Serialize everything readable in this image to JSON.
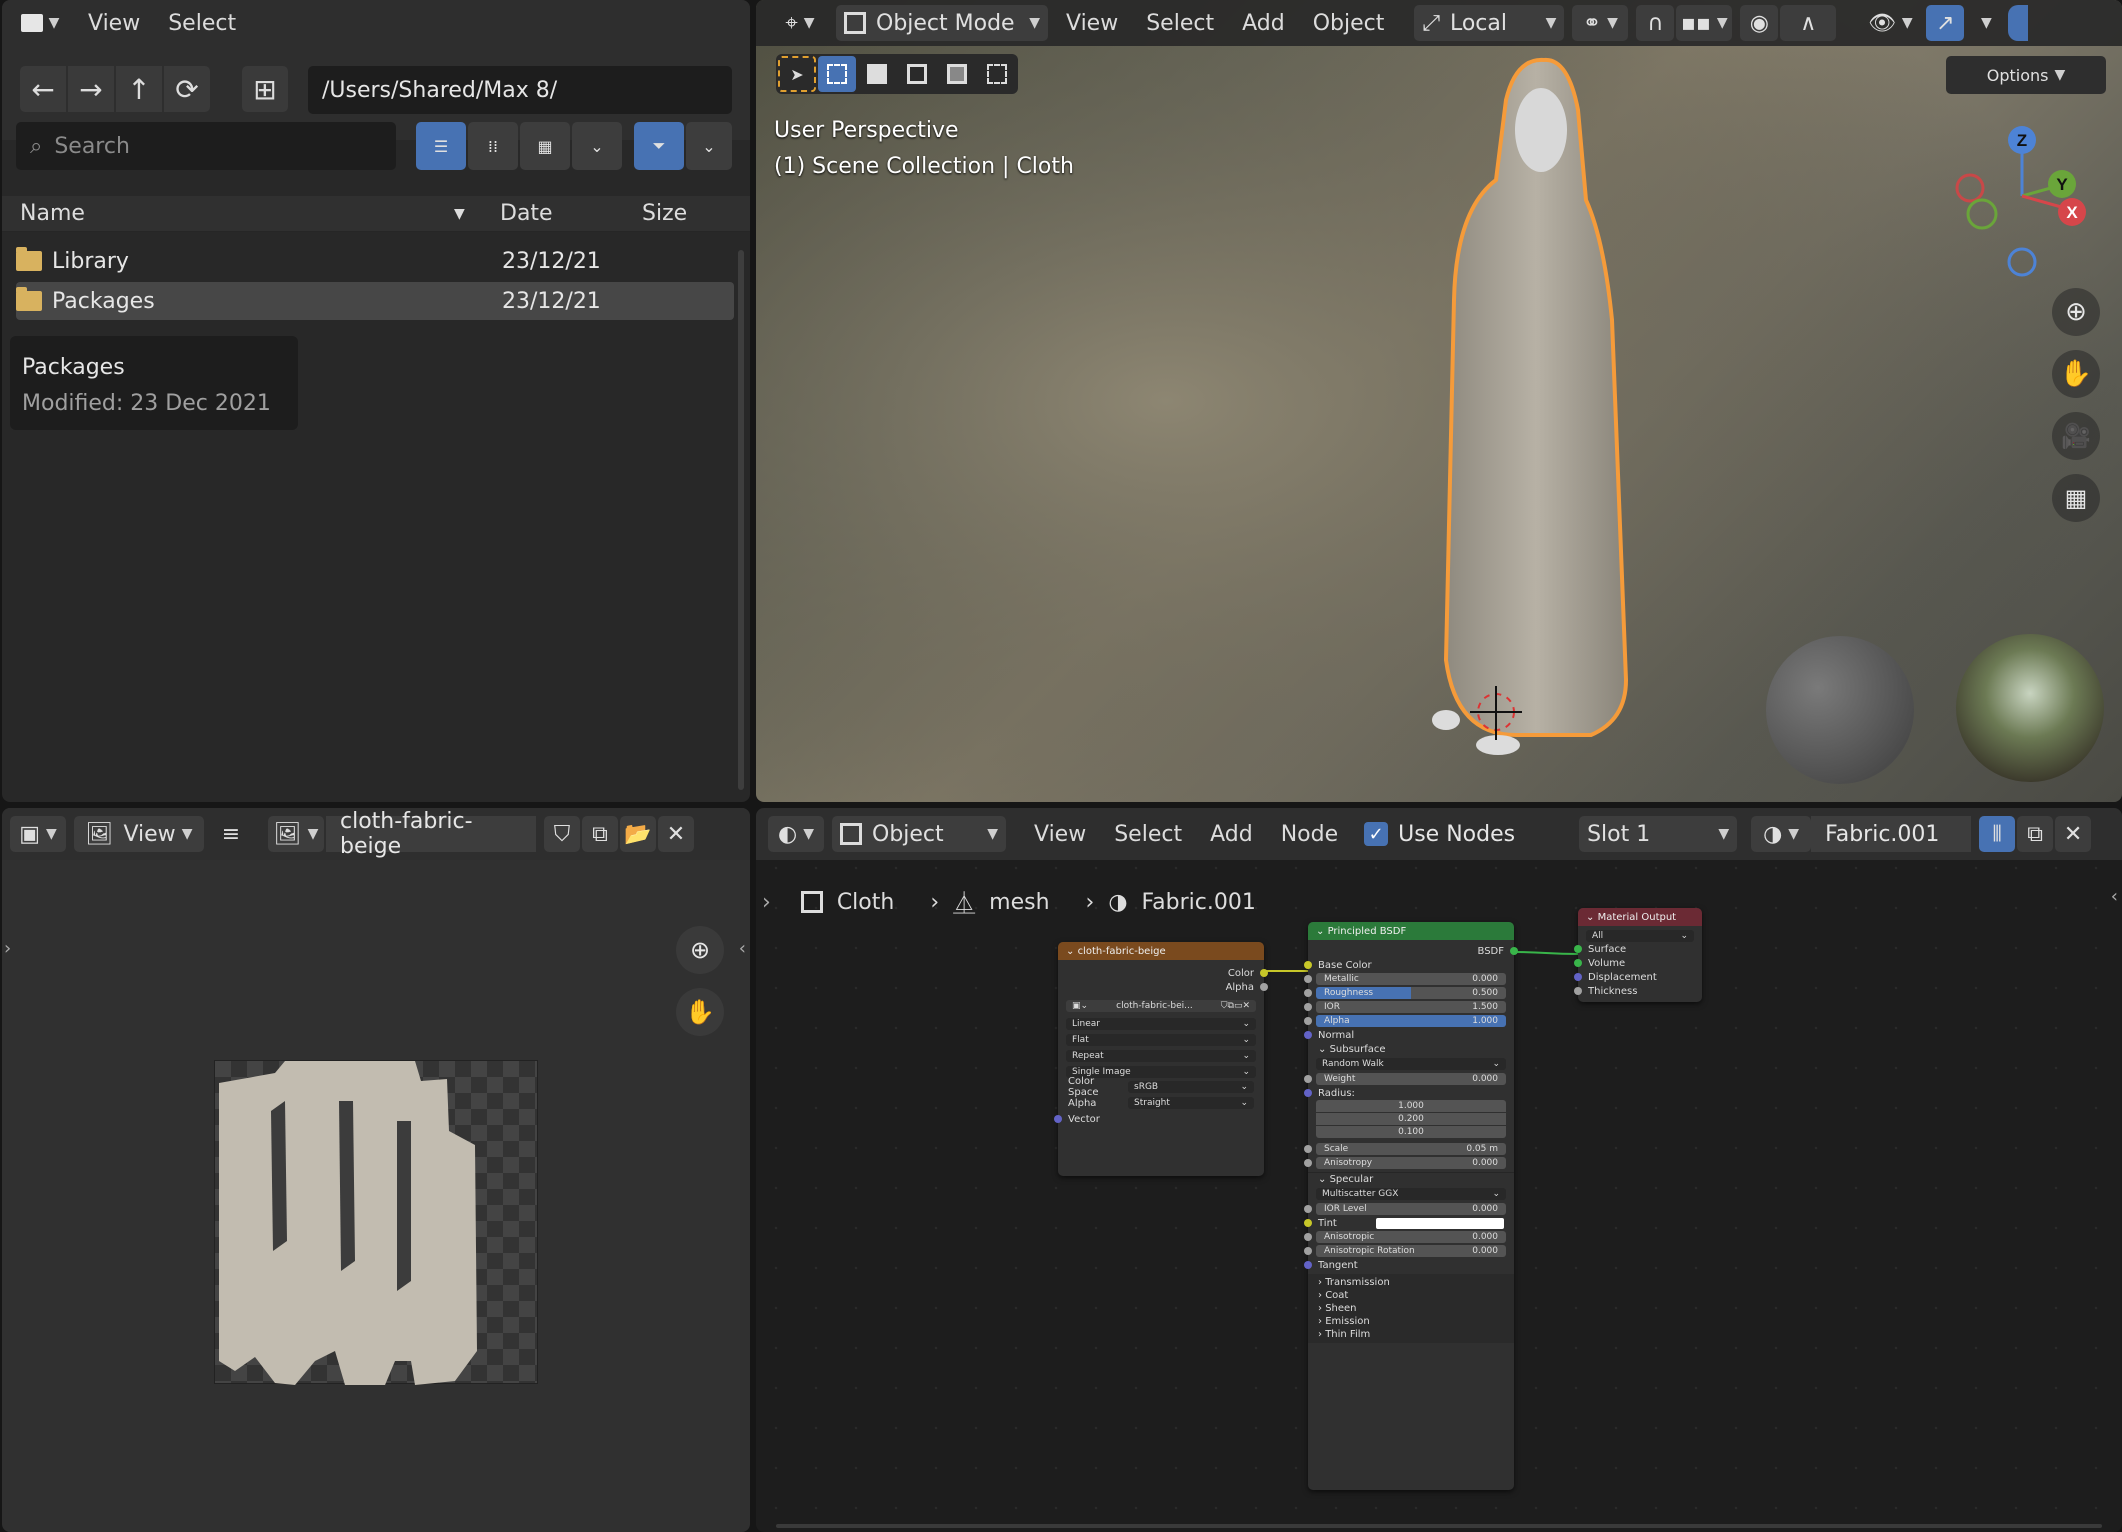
{
  "file_browser": {
    "menus": [
      "View",
      "Select"
    ],
    "path": "/Users/Shared/Max 8/",
    "search_placeholder": "Search",
    "columns": {
      "name": "Name",
      "date": "Date",
      "size": "Size"
    },
    "rows": [
      {
        "name": "Library",
        "date": "23/12/21"
      },
      {
        "name": "Packages",
        "date": "23/12/21"
      }
    ],
    "tooltip": {
      "title": "Packages",
      "detail": "Modified: 23 Dec 2021"
    }
  },
  "viewport": {
    "mode": "Object Mode",
    "menus": [
      "View",
      "Select",
      "Add",
      "Object"
    ],
    "pivot": "Local",
    "options": "Options",
    "overlay_title": "User Perspective",
    "overlay_sub": "(1) Scene Collection | Cloth",
    "gizmo": {
      "z": "Z",
      "y": "Y",
      "x": "X"
    }
  },
  "image_editor": {
    "view": "View",
    "image_name": "cloth-fabric-beige"
  },
  "node_editor": {
    "object_mode": "Object",
    "menus": [
      "View",
      "Select",
      "Add",
      "Node"
    ],
    "use_nodes": "Use Nodes",
    "slot": "Slot 1",
    "material": "Fabric.001",
    "breadcrumb": [
      "Cloth",
      "mesh",
      "Fabric.001"
    ],
    "image_node": {
      "title": "cloth-fabric-beige",
      "out_color": "Color",
      "out_alpha": "Alpha",
      "image": "cloth-fabric-bei...",
      "interp": "Linear",
      "proj": "Flat",
      "ext": "Repeat",
      "source": "Single Image",
      "cs_label": "Color Space",
      "cs_value": "sRGB",
      "alpha_label": "Alpha",
      "alpha_value": "Straight",
      "in_vector": "Vector"
    },
    "bsdf_node": {
      "title": "Principled BSDF",
      "out": "BSDF",
      "base_color": "Base Color",
      "metallic": {
        "label": "Metallic",
        "value": "0.000"
      },
      "roughness": {
        "label": "Roughness",
        "value": "0.500",
        "fill": 0.5
      },
      "ior": {
        "label": "IOR",
        "value": "1.500"
      },
      "alpha": {
        "label": "Alpha",
        "value": "1.000",
        "fill": 1.0
      },
      "normal": "Normal",
      "subsurface": "Subsurface",
      "ss_method": "Random Walk",
      "weight": {
        "label": "Weight",
        "value": "0.000"
      },
      "radius": "Radius:",
      "radius_vals": [
        "1.000",
        "0.200",
        "0.100"
      ],
      "scale": {
        "label": "Scale",
        "value": "0.05 m"
      },
      "anisotropy": {
        "label": "Anisotropy",
        "value": "0.000"
      },
      "specular": "Specular",
      "spec_method": "Multiscatter GGX",
      "ior_level": {
        "label": "IOR Level",
        "value": "0.000"
      },
      "tint": "Tint",
      "anisotropic": {
        "label": "Anisotropic",
        "value": "0.000"
      },
      "aniso_rot": {
        "label": "Anisotropic Rotation",
        "value": "0.000"
      },
      "tangent": "Tangent",
      "panels": [
        "Transmission",
        "Coat",
        "Sheen",
        "Emission",
        "Thin Film"
      ]
    },
    "output_node": {
      "title": "Material Output",
      "target": "All",
      "inputs": [
        "Surface",
        "Volume",
        "Displacement",
        "Thickness"
      ]
    }
  },
  "colors": {
    "accent": "#4772b3",
    "selected_outline": "#f59b3a",
    "bsdf_header": "#2b7a3a",
    "image_header": "#7a4a1e",
    "output_header": "#6b2a34"
  }
}
